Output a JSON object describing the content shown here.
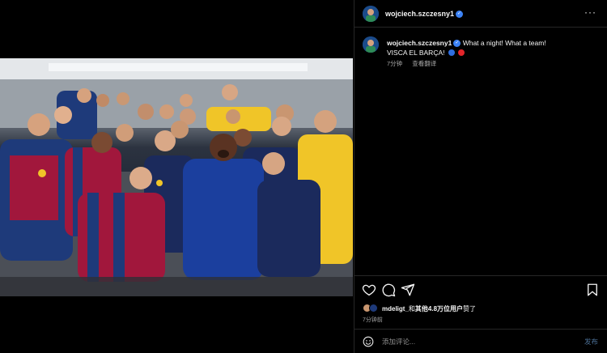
{
  "post": {
    "author": "wojciech.szczesny1",
    "verified_icon": "verified-badge-icon",
    "caption_line1": "What a night! What a team!",
    "caption_line2": "VISCA EL BARÇA!",
    "emoji_blue": "#2f6ee0",
    "emoji_red": "#e3252a",
    "time_ago": "7分钟",
    "translate_label": "查看翻译"
  },
  "photo": {
    "alt_icon": "team-celebration-photo",
    "team_colors": {
      "blaugrana_blue": "#1e3a7a",
      "blaugrana_red": "#a1173c",
      "goalkeeper_yellow": "#f0c528",
      "navy_training": "#1b2a5c"
    }
  },
  "actions": {
    "like_icon": "heart-icon",
    "comment_icon": "comment-icon",
    "share_icon": "share-icon",
    "save_icon": "bookmark-icon"
  },
  "likes": {
    "liker": "mdeligt_",
    "text_middle": "和",
    "others": "其他4.8万位用户",
    "text_end": "赞了",
    "time": "7分钟前"
  },
  "comment": {
    "placeholder": "添加评论...",
    "post_label": "发布"
  },
  "header": {
    "more_icon": "more-options-icon",
    "more_label": "···"
  }
}
